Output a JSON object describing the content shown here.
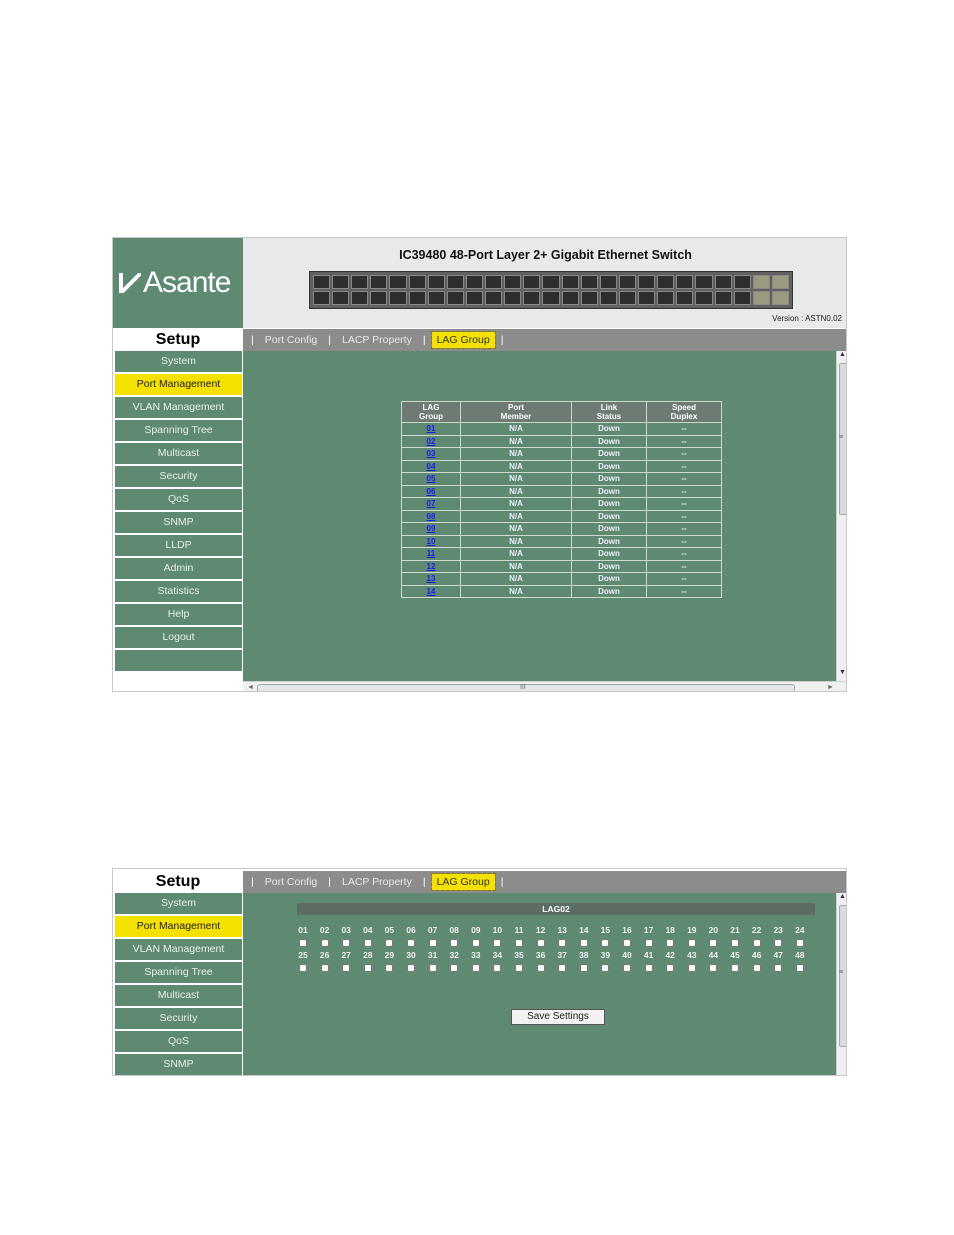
{
  "header": {
    "brand": "Asante",
    "title": "IC39480 48-Port Layer 2+ Gigabit Ethernet Switch",
    "version": "Version : ASTN0.02"
  },
  "setup_label": "Setup",
  "tabs": [
    "Port Config",
    "LACP Property",
    "LAG Group"
  ],
  "tab_separator": "|",
  "active_tab": "LAG Group",
  "sidebar": {
    "items": [
      "System",
      "Port Management",
      "VLAN Management",
      "Spanning Tree",
      "Multicast",
      "Security",
      "QoS",
      "SNMP",
      "LLDP",
      "Admin",
      "Statistics",
      "Help",
      "Logout"
    ],
    "active": "Port Management"
  },
  "lag_table": {
    "headers": [
      [
        "LAG",
        "Group"
      ],
      [
        "Port",
        "Member"
      ],
      [
        "Link",
        "Status"
      ],
      [
        "Speed",
        "Duplex"
      ]
    ],
    "rows": [
      [
        "01",
        "N/A",
        "Down",
        "--"
      ],
      [
        "02",
        "N/A",
        "Down",
        "--"
      ],
      [
        "03",
        "N/A",
        "Down",
        "--"
      ],
      [
        "04",
        "N/A",
        "Down",
        "--"
      ],
      [
        "05",
        "N/A",
        "Down",
        "--"
      ],
      [
        "06",
        "N/A",
        "Down",
        "--"
      ],
      [
        "07",
        "N/A",
        "Down",
        "--"
      ],
      [
        "08",
        "N/A",
        "Down",
        "--"
      ],
      [
        "09",
        "N/A",
        "Down",
        "--"
      ],
      [
        "10",
        "N/A",
        "Down",
        "--"
      ],
      [
        "11",
        "N/A",
        "Down",
        "--"
      ],
      [
        "12",
        "N/A",
        "Down",
        "--"
      ],
      [
        "13",
        "N/A",
        "Down",
        "--"
      ],
      [
        "14",
        "N/A",
        "Down",
        "--"
      ]
    ]
  },
  "scroll_glyphs": {
    "up": "▲",
    "down": "▼",
    "left": "◄",
    "right": "►",
    "hgrip": "III",
    "vgrip": "≡"
  },
  "lag_detail": {
    "title": "LAG02",
    "ports_row1": [
      "01",
      "02",
      "03",
      "04",
      "05",
      "06",
      "07",
      "08",
      "09",
      "10",
      "11",
      "12",
      "13",
      "14",
      "15",
      "16",
      "17",
      "18",
      "19",
      "20",
      "21",
      "22",
      "23",
      "24"
    ],
    "ports_row2": [
      "25",
      "26",
      "27",
      "28",
      "29",
      "30",
      "31",
      "32",
      "33",
      "34",
      "35",
      "36",
      "37",
      "38",
      "39",
      "40",
      "41",
      "42",
      "43",
      "44",
      "45",
      "46",
      "47",
      "48"
    ],
    "save_label": "Save Settings"
  },
  "colors": {
    "content_bg": "#5e8a72",
    "tab_bar": "#8c8c8c",
    "active_yellow": "#f4e100",
    "link_blue": "#1a1af0"
  }
}
